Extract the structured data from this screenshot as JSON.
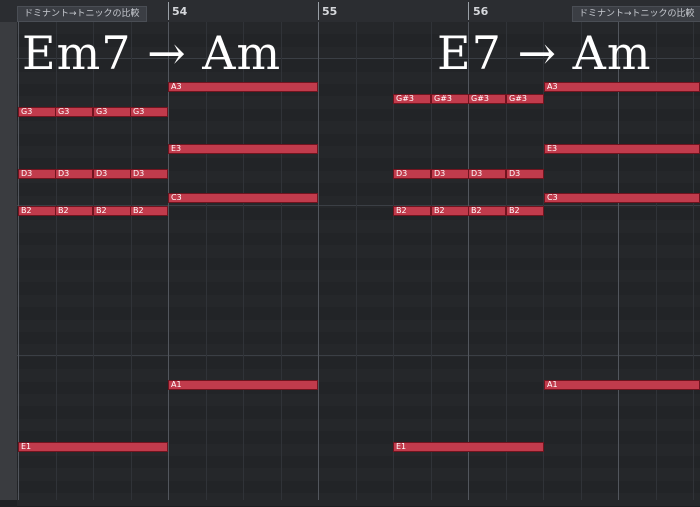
{
  "ruler": {
    "bars": [
      "54",
      "55",
      "56"
    ],
    "markers": [
      "ドミナント→トニックの比較",
      "ドミナント→トニックの比較"
    ]
  },
  "chords": [
    "Em7 → Am",
    "E7 → Am"
  ],
  "notes": {
    "em7_g": "G3",
    "em7_d": "D3",
    "em7_b": "B2",
    "em7_e": "E1",
    "e7_gs": "G#3",
    "e7_d": "D3",
    "e7_b": "B2",
    "e7_e": "E1",
    "am_a3": "A3",
    "am_e3": "E3",
    "am_c3": "C3",
    "am_a1": "A1"
  },
  "colors": {
    "note_fill": "#c13b4c",
    "note_border": "#70141f",
    "grid_bg": "#232528",
    "ruler_bg": "#2b2d31"
  }
}
